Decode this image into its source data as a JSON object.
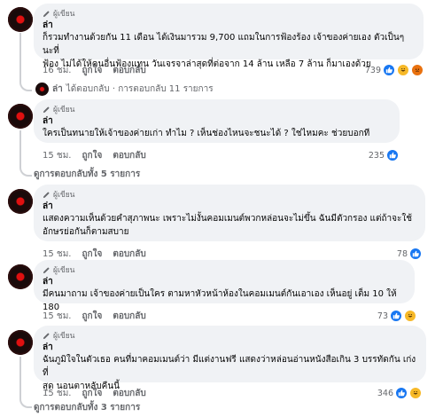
{
  "author_badge": "ผู้เขียน",
  "comments": [
    {
      "name": "ล่า",
      "lines": [
        "ก็รวมทำงานด้วยกัน 11 เดือน ได้เงินมารวม 9,700 แถมในการฟ้องร้อง เจ้าของค่ายเอง ตัวเป็นๆ นะที่",
        "ฟ้อง ไม่ได้ให้คนอื่นฟ้องแทน วันเจรจาล่าสุดที่ต่อจาก 14 ล้าน เหลือ 7 ล้าน ก็มาเองด้วย"
      ],
      "time": "16 ชม.",
      "like": "ถูกใจ",
      "reply": "ตอบกลับ",
      "reaction_count": "739",
      "reactions": [
        "like-icon",
        "haha-icon",
        "angry-icon"
      ]
    },
    {
      "name": "ล่า",
      "lines": [
        "ใครเป็นทนายให้เจ้าของค่ายเก่า ทำไม ? เห็นช่องไหนจะชนะได้ ? ใช่ไหมคะ ช่วยบอกที"
      ],
      "time": "15 ชม.",
      "like": "ถูกใจ",
      "reply": "ตอบกลับ",
      "reaction_count": "235",
      "reactions": [
        "like-icon"
      ]
    },
    {
      "name": "ล่า",
      "lines": [
        "แสดงความเห็นด้วยคำสุภาพนะ เพราะไม่งั้นคอมเมนต์พวกหล่อนจะไม่ขึ้น ฉันมีตัวกรอง แต่ถ้าจะใช้",
        "อักษรย่อกันก็ตามสบาย"
      ],
      "time": "15 ชม.",
      "like": "ถูกใจ",
      "reply": "ตอบกลับ",
      "reaction_count": "78",
      "reactions": [
        "like-icon"
      ]
    },
    {
      "name": "ล่า",
      "lines": [
        "มีคนมาถาม เจ้าของค่ายเป็นใคร ตามหาหัวหน้าห้องในคอมเมนต์กันเอาเอง เห็นอยู่ เต็ม 10 ให้ 180"
      ],
      "time": "15 ชม.",
      "like": "ถูกใจ",
      "reply": "ตอบกลับ",
      "reaction_count": "73",
      "reactions": [
        "like-icon",
        "haha-icon"
      ]
    },
    {
      "name": "ล่า",
      "lines": [
        "ฉันภูมิใจในตัวเธอ คนที่มาคอมเมนต์ว่า มีแต่งานฟรี แสดงว่าหล่อนอ่านหนังสือเกิน 3 บรรทัดกัน เก่งที่",
        "สุด นอนตาหลับคืนนี้"
      ],
      "time": "15 ชม.",
      "like": "ถูกใจ",
      "reply": "ตอบกลับ",
      "reaction_count": "346",
      "reactions": [
        "like-icon",
        "haha-icon"
      ]
    }
  ],
  "reply_links": {
    "first": {
      "name": "ล่า",
      "text": "ได้ตอบกลับ · การตอบกลับ 11 รายการ"
    },
    "second": "ดูการตอบกลับทั้ง 5 รายการ",
    "third": "ดูการตอบกลับทั้ง 3 รายการ"
  }
}
